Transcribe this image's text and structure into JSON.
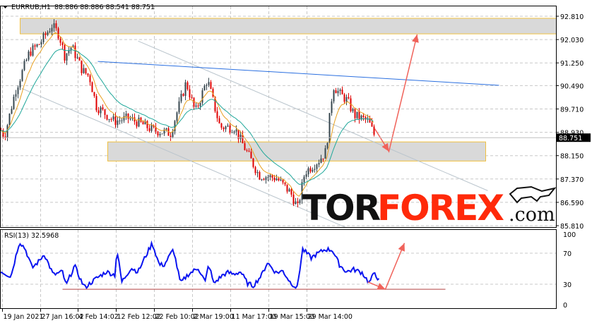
{
  "window": {
    "symbol_timeframe": "EURRUB,H1",
    "ohlc_readout": "88.886 88.886 88.541 88.751"
  },
  "watermark": {
    "part1": "TOR",
    "part2": "FOREX",
    "part3": ".com"
  },
  "colors": {
    "up_candle": "#37474f",
    "down_candle": "#e00000",
    "ma_fast": "#e8a020",
    "ma_slow": "#1fa79a",
    "trendline": "#2a6fe0",
    "channel": "#b9c4cc",
    "arrow": "#f0625a",
    "rsi": "#0a14f0",
    "rsi_support": "#b04040",
    "zone_fill": "#d9d9d9",
    "zone_border": "#f0c040"
  },
  "chart_data": [
    {
      "type": "candlestick",
      "title": "EURRUB,H1",
      "x_unit": "bar index",
      "ylim": [
        85.81,
        92.81
      ],
      "yticks": [
        "92.810",
        "92.030",
        "91.250",
        "90.490",
        "89.710",
        "88.930",
        "88.150",
        "87.370",
        "86.590",
        "85.810"
      ],
      "ytick_values": [
        92.81,
        92.03,
        91.25,
        90.49,
        89.71,
        88.93,
        88.15,
        87.37,
        86.59,
        85.81
      ],
      "current_price": "88.751",
      "close_path": [
        [
          0,
          89.0
        ],
        [
          5,
          88.8
        ],
        [
          20,
          90.3
        ],
        [
          40,
          91.6
        ],
        [
          55,
          91.9
        ],
        [
          72,
          92.5
        ],
        [
          82,
          92.2
        ],
        [
          90,
          91.5
        ],
        [
          100,
          91.8
        ],
        [
          115,
          91.0
        ],
        [
          125,
          90.8
        ],
        [
          135,
          89.8
        ],
        [
          160,
          89.3
        ],
        [
          180,
          89.4
        ],
        [
          200,
          89.2
        ],
        [
          215,
          89.0
        ],
        [
          240,
          88.9
        ],
        [
          262,
          90.6
        ],
        [
          275,
          89.6
        ],
        [
          292,
          90.7
        ],
        [
          310,
          89.1
        ],
        [
          330,
          89.1
        ],
        [
          345,
          88.4
        ],
        [
          365,
          87.5
        ],
        [
          390,
          87.4
        ],
        [
          410,
          86.9
        ],
        [
          420,
          86.4
        ],
        [
          430,
          87.6
        ],
        [
          450,
          88.0
        ],
        [
          460,
          88.3
        ],
        [
          470,
          90.5
        ],
        [
          480,
          90.2
        ],
        [
          490,
          90.0
        ],
        [
          500,
          89.5
        ],
        [
          520,
          89.3
        ],
        [
          530,
          88.75
        ]
      ],
      "zones": [
        {
          "x_from": 28,
          "x_to": 787,
          "price_low": 92.22,
          "price_high": 92.74
        },
        {
          "x_from": 152,
          "x_to": 687,
          "price_low": 87.97,
          "price_high": 88.61
        }
      ],
      "trendline": [
        [
          138,
          91.3
        ],
        [
          706,
          90.5
        ]
      ],
      "channel_upper": [
        [
          195,
          91.98
        ],
        [
          690,
          86.98
        ]
      ],
      "channel_lower": [
        [
          30,
          90.4
        ],
        [
          490,
          85.74
        ]
      ],
      "forecast_arrow": [
        [
          530,
          89.05
        ],
        [
          550,
          88.29
        ],
        [
          590,
          92.2
        ]
      ]
    },
    {
      "type": "line",
      "title": "RSI(13) 32.5968",
      "ylim": [
        0,
        100
      ],
      "yticks": [
        "100",
        "70",
        "30",
        "0"
      ],
      "ytick_values": [
        100,
        70,
        30,
        0
      ],
      "levels": [
        70,
        30
      ],
      "values_path": [
        [
          0,
          47
        ],
        [
          15,
          40
        ],
        [
          27,
          85
        ],
        [
          35,
          76
        ],
        [
          45,
          51
        ],
        [
          55,
          60
        ],
        [
          62,
          69
        ],
        [
          75,
          42
        ],
        [
          88,
          46
        ],
        [
          93,
          28
        ],
        [
          105,
          54
        ],
        [
          115,
          33
        ],
        [
          120,
          26
        ],
        [
          135,
          37
        ],
        [
          150,
          46
        ],
        [
          162,
          42
        ],
        [
          165,
          74
        ],
        [
          172,
          33
        ],
        [
          185,
          51
        ],
        [
          195,
          46
        ],
        [
          205,
          65
        ],
        [
          215,
          83
        ],
        [
          225,
          55
        ],
        [
          232,
          55
        ],
        [
          245,
          75
        ],
        [
          255,
          31
        ],
        [
          265,
          42
        ],
        [
          280,
          51
        ],
        [
          290,
          33
        ],
        [
          295,
          56
        ],
        [
          302,
          31
        ],
        [
          315,
          42
        ],
        [
          322,
          45
        ],
        [
          330,
          43
        ],
        [
          340,
          46
        ],
        [
          350,
          31
        ],
        [
          358,
          28
        ],
        [
          370,
          42
        ],
        [
          378,
          58
        ],
        [
          390,
          45
        ],
        [
          400,
          47
        ],
        [
          410,
          33
        ],
        [
          420,
          25
        ],
        [
          428,
          75
        ],
        [
          440,
          64
        ],
        [
          448,
          69
        ],
        [
          460,
          75
        ],
        [
          470,
          74
        ],
        [
          480,
          55
        ],
        [
          490,
          46
        ],
        [
          500,
          49
        ],
        [
          512,
          45
        ],
        [
          522,
          32
        ],
        [
          530,
          45
        ],
        [
          537,
          33
        ]
      ],
      "support_line": [
        [
          88,
          23.5
        ],
        [
          630,
          23.5
        ]
      ],
      "forecast_arrow": [
        [
          520,
          33
        ],
        [
          545,
          23.5
        ],
        [
          572,
          83
        ]
      ]
    }
  ],
  "time_axis": {
    "labels": [
      "19 Jan 2021",
      "27 Jan 16:02",
      "4 Feb 14:02",
      "12 Feb 12:02",
      "22 Feb 10:02",
      "2 Mar 19:00",
      "11 Mar 17:00",
      "19 Mar 15:00",
      "29 Mar 14:00"
    ],
    "label_bars": [
      3,
      57,
      110,
      164,
      218,
      272,
      326,
      380,
      434
    ]
  }
}
